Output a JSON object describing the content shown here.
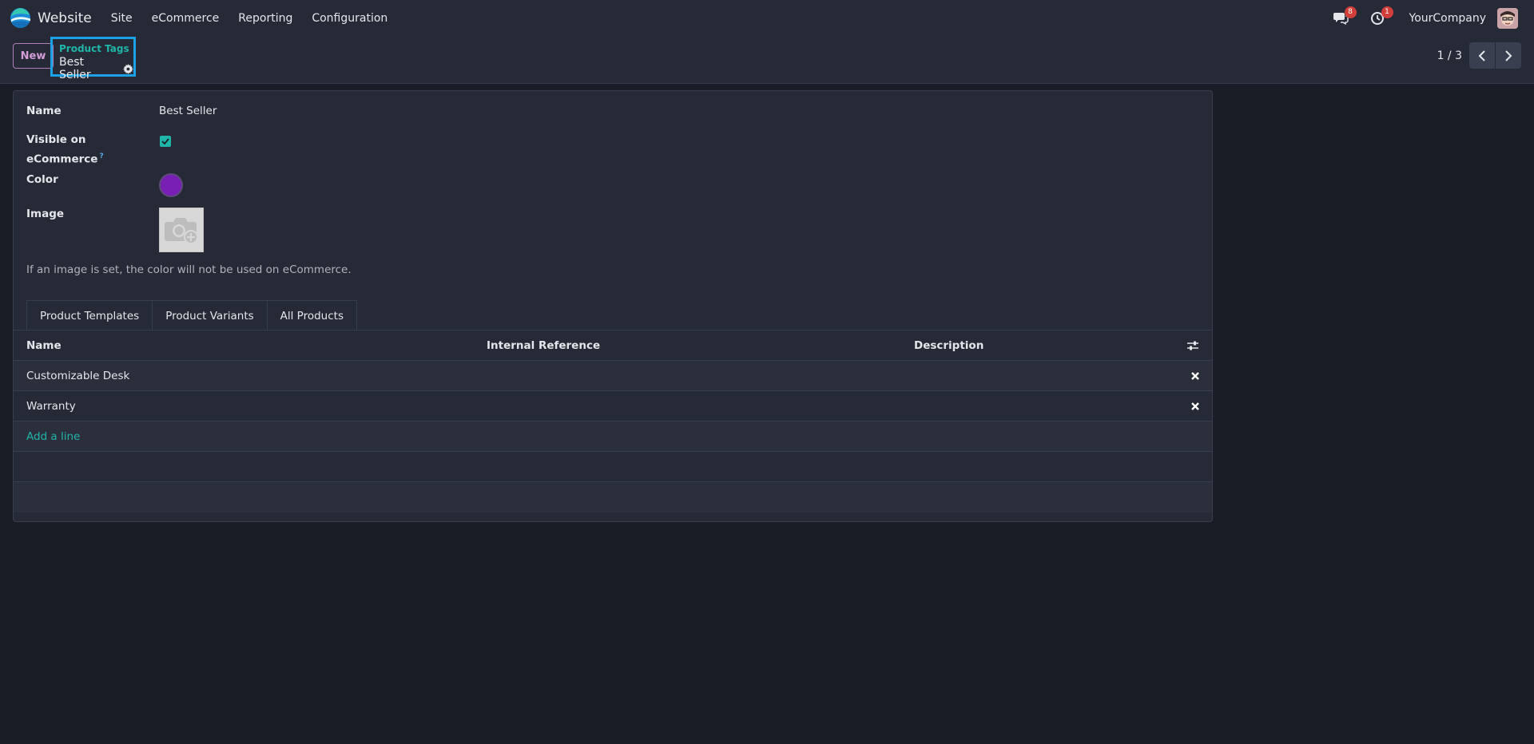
{
  "navbar": {
    "app_name": "Website",
    "menu": [
      "Site",
      "eCommerce",
      "Reporting",
      "Configuration"
    ],
    "messages_badge": "8",
    "activities_badge": "1",
    "company": "YourCompany"
  },
  "control_panel": {
    "new_label": "New",
    "breadcrumb_parent": "Product Tags",
    "breadcrumb_current": "Best Seller",
    "pager_value": "1 / 3"
  },
  "form": {
    "name_label": "Name",
    "name_value": "Best Seller",
    "visible_label": "Visible on eCommerce",
    "visible_value": true,
    "help_mark": "?",
    "color_label": "Color",
    "color_value": "#7a1fb6",
    "image_label": "Image",
    "help_text": "If an image is set, the color will not be used on eCommerce."
  },
  "tabs": [
    "Product Templates",
    "Product Variants",
    "All Products"
  ],
  "list": {
    "columns": [
      "Name",
      "Internal Reference",
      "Description"
    ],
    "rows": [
      {
        "name": "Customizable Desk",
        "ref": "",
        "desc": ""
      },
      {
        "name": "Warranty",
        "ref": "",
        "desc": ""
      }
    ],
    "add_line": "Add a line"
  },
  "colors": {
    "accent": "#1fb5a8",
    "primary": "#d49cd8",
    "focus_outline": "#1aa1e6",
    "badge": "#d23f3a"
  }
}
